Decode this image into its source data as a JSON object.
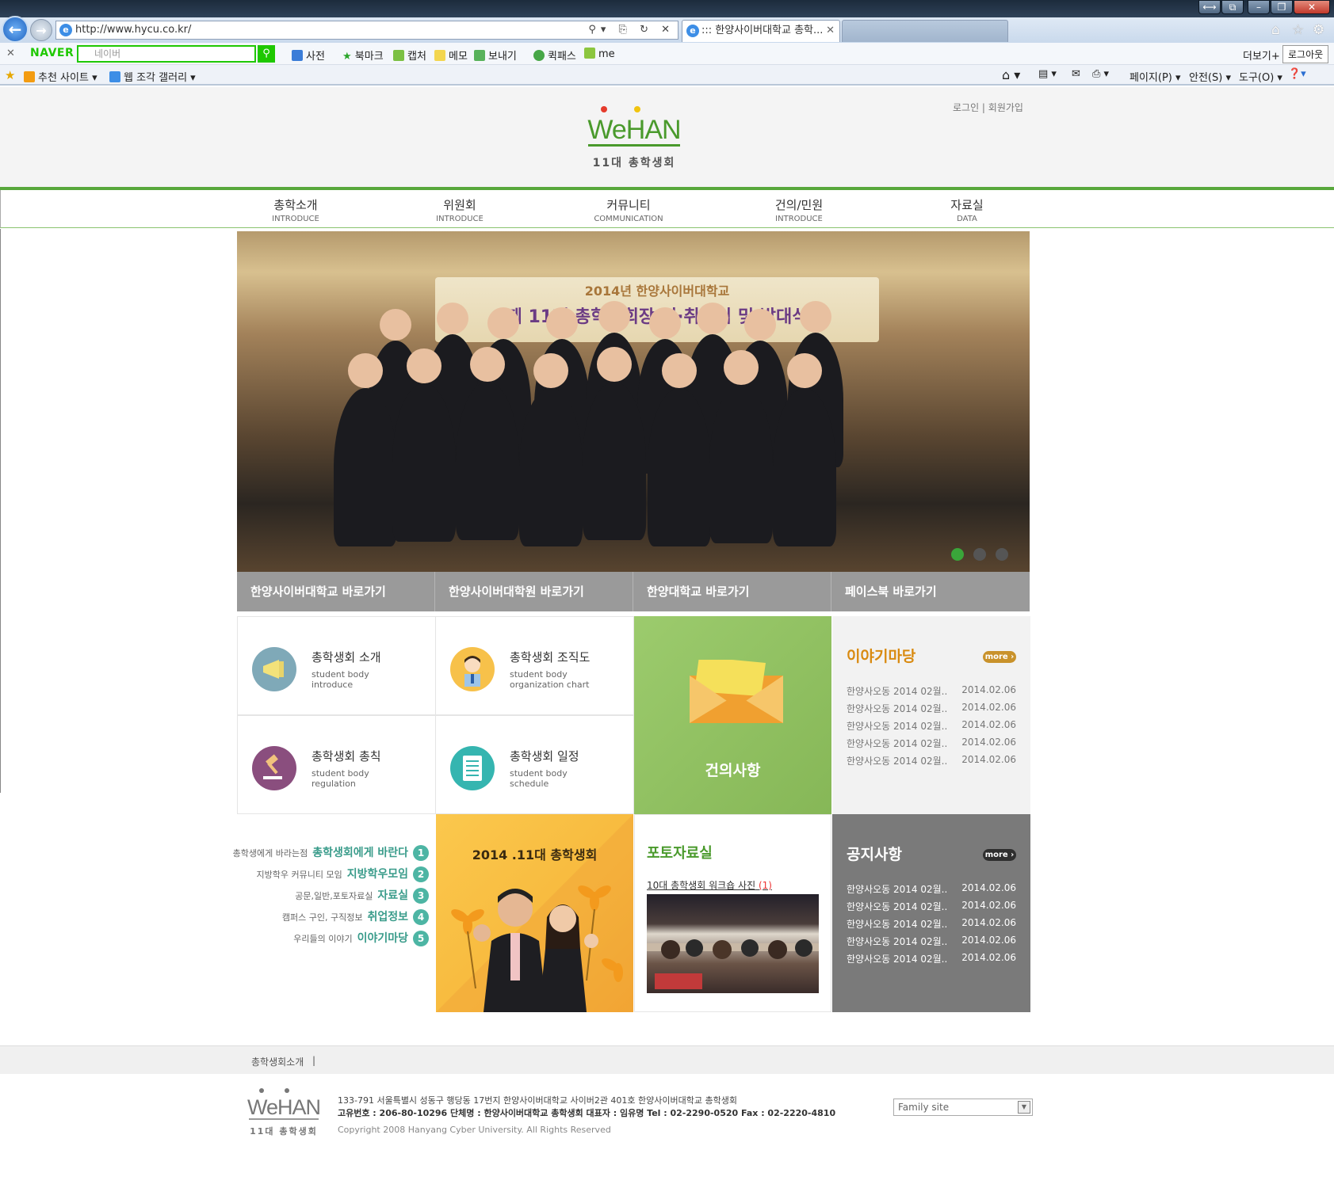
{
  "browser": {
    "address": "http://www.hycu.co.kr/",
    "tab_active": "::: 한양사이버대학교 총학...",
    "tab_inactive": "",
    "toolbar": {
      "naver_logo": "NAVER",
      "search_placeholder": "네이버",
      "dictionary": "사전",
      "bookmark": "북마크",
      "capture": "캡처",
      "memo": "메모",
      "send": "보내기",
      "quickpass": "퀵패스",
      "me": "me",
      "more": "더보기+",
      "logout": "로그아웃"
    },
    "favbar": {
      "recommended": "추천 사이트",
      "web_slice": "웹 조각 갤러리",
      "page_menu": "페이지(P)",
      "safety_menu": "안전(S)",
      "tools_menu": "도구(O)"
    }
  },
  "site": {
    "logo": {
      "name": "WeHAN",
      "sub": "11대 총학생회"
    },
    "util_links": "로그인 | 회원가입",
    "nav": [
      {
        "ko": "총학소개",
        "en": "INTRODUCE"
      },
      {
        "ko": "위원회",
        "en": "INTRODUCE"
      },
      {
        "ko": "커뮤니티",
        "en": "COMMUNICATION"
      },
      {
        "ko": "건의/민원",
        "en": "INTRODUCE"
      },
      {
        "ko": "자료실",
        "en": "DATA"
      }
    ],
    "hero": {
      "banner_line1": "2014년 한양사이버대학교",
      "banner_line2": "제 11대 총학생회장 이·취임식 및 발대식"
    },
    "quick_links": [
      "한양사이버대학교 바로가기",
      "한양사이버대학원 바로가기",
      "한양대학교 바로가기",
      "페이스북 바로가기"
    ],
    "cards": [
      {
        "title": "총학생회 소개",
        "en1": "student body",
        "en2": "introduce"
      },
      {
        "title": "총학생회 조직도",
        "en1": "student body",
        "en2": "organization chart"
      },
      {
        "title": "총학생회 총칙",
        "en1": "student body",
        "en2": "regulation"
      },
      {
        "title": "총학생회 일정",
        "en1": "student body",
        "en2": "schedule"
      }
    ],
    "suggest_label": "건의사항",
    "story_board": {
      "title": "이야기마당",
      "more": "more ›",
      "rows": [
        {
          "title": "한양사오동 2014 02월..",
          "date": "2014.02.06"
        },
        {
          "title": "한양사오동 2014 02월..",
          "date": "2014.02.06"
        },
        {
          "title": "한양사오동 2014 02월..",
          "date": "2014.02.06"
        },
        {
          "title": "한양사오동 2014 02월..",
          "date": "2014.02.06"
        },
        {
          "title": "한양사오동 2014 02월..",
          "date": "2014.02.06"
        }
      ]
    },
    "shortcuts": [
      {
        "desc": "총학생에게 바라는점",
        "key": "총학생회에게 바란다",
        "num": "1"
      },
      {
        "desc": "지방학우 커뮤니티 모임",
        "key": "지방학우모임",
        "num": "2"
      },
      {
        "desc": "공문,일반,포토자료실",
        "key": "자료실",
        "num": "3"
      },
      {
        "desc": "캠퍼스 구인, 구직정보",
        "key": "취업정보",
        "num": "4"
      },
      {
        "desc": "우리들의 이야기",
        "key": "이야기마당",
        "num": "5"
      }
    ],
    "promo_title": "2014 .11대 총학생회",
    "photo": {
      "title": "포토자료실",
      "caption": "10대 총학생회 워크숍 사진",
      "count": "(1)"
    },
    "notice_board": {
      "title": "공지사항",
      "more": "more ›",
      "rows": [
        {
          "title": "한양사오동 2014 02월..",
          "date": "2014.02.06"
        },
        {
          "title": "한양사오동 2014 02월..",
          "date": "2014.02.06"
        },
        {
          "title": "한양사오동 2014 02월..",
          "date": "2014.02.06"
        },
        {
          "title": "한양사오동 2014 02월..",
          "date": "2014.02.06"
        },
        {
          "title": "한양사오동 2014 02월..",
          "date": "2014.02.06"
        }
      ]
    },
    "footer": {
      "menu": "총학생회소개",
      "sep": "|",
      "address": "133-791 서울특별시 성동구 행당동 17번지 한양사이버대학교 사이버2관 401호 한양사이버대학교 총학생회",
      "info": "고유번호 : 206-80-10296   단체명 : 한양사이버대학교 총학생회   대표자 : 임유명   Tel : 02-2290-0520   Fax : 02-2220-4810",
      "copyright": "Copyright 2008 Hanyang Cyber University. All Rights Reserved",
      "family_site": "Family site"
    }
  },
  "colors": {
    "brand_green": "#4a9a2c",
    "teal": "#3a9c8b",
    "notice_bg": "#7a7a7a",
    "story_bg": "#f2f2f2"
  }
}
